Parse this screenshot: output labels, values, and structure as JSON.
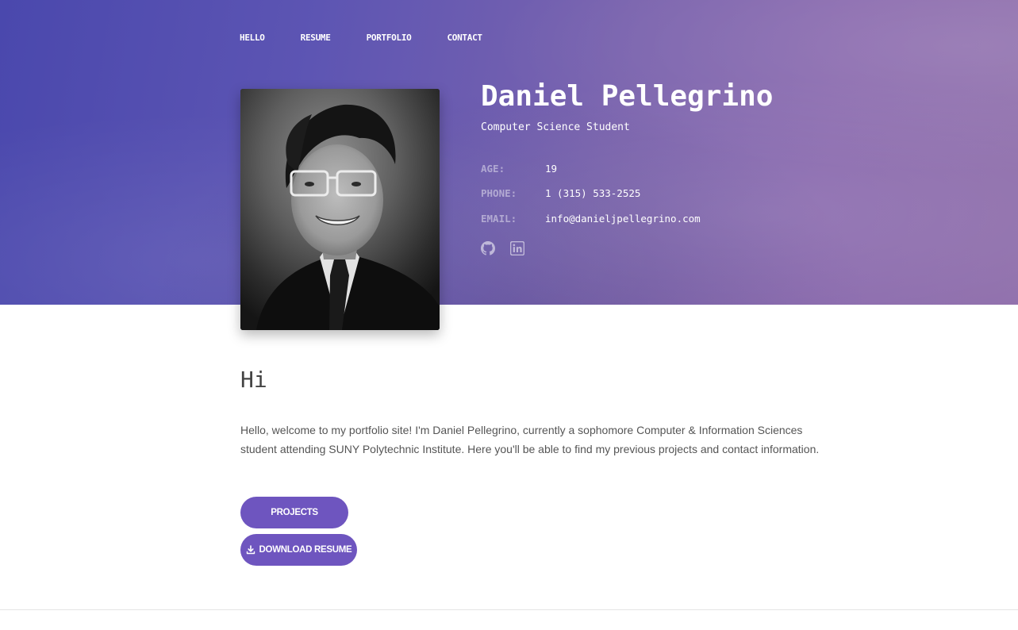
{
  "nav": {
    "items": [
      {
        "label": "HELLO"
      },
      {
        "label": "RESUME"
      },
      {
        "label": "PORTFOLIO"
      },
      {
        "label": "CONTACT"
      }
    ]
  },
  "profile": {
    "name": "Daniel Pellegrino",
    "subtitle": "Computer Science Student",
    "age_label": "AGE:",
    "age_value": "19",
    "phone_label": "PHONE:",
    "phone_value": "1 (315) 533-2525",
    "email_label": "EMAIL:",
    "email_value": "info@danieljpellegrino.com",
    "social_icons": [
      "github-icon",
      "linkedin-icon"
    ]
  },
  "about": {
    "heading": "Hi",
    "text": "Hello, welcome to my portfolio site! I'm Daniel Pellegrino, currently a sophomore Computer & Information Sciences student attending SUNY Polytechnic Institute. Here you'll be able to find my previous projects and contact information."
  },
  "buttons": {
    "projects_label": "PROJECTS",
    "resume_label": "DOWNLOAD RESUME",
    "resume_icon": "download-icon"
  },
  "colors": {
    "accent": "#6e55bf",
    "hero_start": "#4a48ad",
    "hero_end": "#9070ac"
  }
}
